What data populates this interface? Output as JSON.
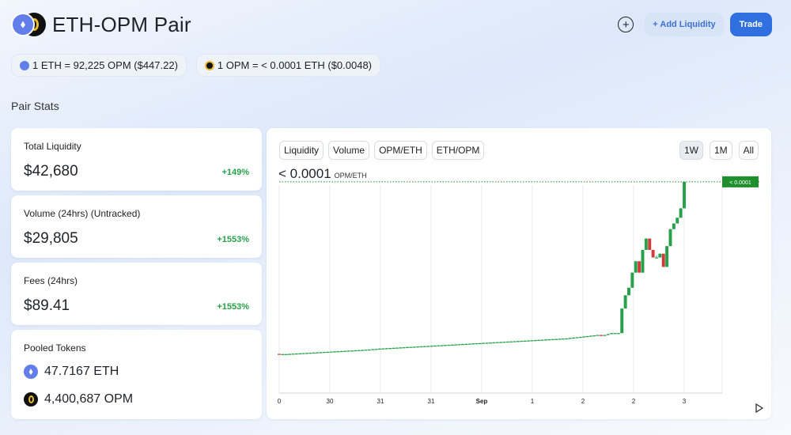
{
  "header": {
    "title": "ETH-OPM Pair",
    "add_liquidity_label": "+ Add Liquidity",
    "trade_label": "Trade",
    "icons": [
      "eth-logo",
      "opm-logo",
      "plus-circle-icon"
    ]
  },
  "prices": {
    "eth_price": "1 ETH = 92,225 OPM ($447.22)",
    "opm_price": "1 OPM = < 0.0001 ETH ($0.0048)"
  },
  "section_title": "Pair Stats",
  "stats": [
    {
      "label": "Total Liquidity",
      "value": "$42,680",
      "change": "+149%"
    },
    {
      "label": "Volume (24hrs) (Untracked)",
      "value": "$29,805",
      "change": "+1553%"
    },
    {
      "label": "Fees (24hrs)",
      "value": "$89.41",
      "change": "+1553%"
    }
  ],
  "pooled": {
    "label": "Pooled Tokens",
    "tokens": [
      {
        "amount": "47.7167 ETH",
        "icon": "eth-icon"
      },
      {
        "amount": "4,400,687 OPM",
        "icon": "opm-icon"
      }
    ]
  },
  "chart": {
    "tabs": [
      "Liquidity",
      "Volume",
      "OPM/ETH",
      "ETH/OPM"
    ],
    "ranges": [
      "1W",
      "1M",
      "All"
    ],
    "active_range": "1W",
    "price": "< 0.0001",
    "price_unit": "OPM/ETH",
    "last_price_label": "< 0.0001",
    "colors": {
      "up": "#27a04a",
      "down": "#d23a3a",
      "last_price": "#1f8f2e",
      "grid": "#e6e8ec"
    }
  },
  "chart_data": {
    "type": "candlestick",
    "x_tick_labels": [
      "0",
      "30",
      "31",
      "31",
      "Sep",
      "1",
      "2",
      "2",
      "3"
    ],
    "y_ticks": [],
    "price_level_label": "< 0.0001",
    "last_value": 1.0,
    "ylim": [
      0,
      1.1
    ],
    "candles": [
      {
        "o": 0.09,
        "c": 0.088,
        "h": 0.09,
        "l": 0.087
      },
      {
        "o": 0.088,
        "c": 0.089,
        "h": 0.09,
        "l": 0.087
      },
      {
        "o": 0.089,
        "c": 0.089,
        "h": 0.09,
        "l": 0.088
      },
      {
        "o": 0.089,
        "c": 0.09,
        "h": 0.091,
        "l": 0.088
      },
      {
        "o": 0.09,
        "c": 0.091,
        "h": 0.092,
        "l": 0.089
      },
      {
        "o": 0.091,
        "c": 0.092,
        "h": 0.093,
        "l": 0.09
      },
      {
        "o": 0.092,
        "c": 0.093,
        "h": 0.094,
        "l": 0.091
      },
      {
        "o": 0.093,
        "c": 0.094,
        "h": 0.095,
        "l": 0.092
      },
      {
        "o": 0.094,
        "c": 0.095,
        "h": 0.096,
        "l": 0.093
      },
      {
        "o": 0.095,
        "c": 0.096,
        "h": 0.097,
        "l": 0.094
      },
      {
        "o": 0.096,
        "c": 0.097,
        "h": 0.098,
        "l": 0.095
      },
      {
        "o": 0.097,
        "c": 0.098,
        "h": 0.099,
        "l": 0.096
      },
      {
        "o": 0.098,
        "c": 0.099,
        "h": 0.1,
        "l": 0.097
      },
      {
        "o": 0.099,
        "c": 0.1,
        "h": 0.101,
        "l": 0.098
      },
      {
        "o": 0.1,
        "c": 0.101,
        "h": 0.102,
        "l": 0.099
      },
      {
        "o": 0.101,
        "c": 0.102,
        "h": 0.103,
        "l": 0.1
      },
      {
        "o": 0.102,
        "c": 0.103,
        "h": 0.104,
        "l": 0.101
      },
      {
        "o": 0.103,
        "c": 0.104,
        "h": 0.105,
        "l": 0.102
      },
      {
        "o": 0.104,
        "c": 0.105,
        "h": 0.106,
        "l": 0.103
      },
      {
        "o": 0.105,
        "c": 0.106,
        "h": 0.107,
        "l": 0.104
      },
      {
        "o": 0.106,
        "c": 0.107,
        "h": 0.108,
        "l": 0.105
      },
      {
        "o": 0.107,
        "c": 0.108,
        "h": 0.109,
        "l": 0.106
      },
      {
        "o": 0.108,
        "c": 0.109,
        "h": 0.11,
        "l": 0.107
      },
      {
        "o": 0.109,
        "c": 0.11,
        "h": 0.111,
        "l": 0.108
      },
      {
        "o": 0.11,
        "c": 0.111,
        "h": 0.112,
        "l": 0.109
      },
      {
        "o": 0.111,
        "c": 0.112,
        "h": 0.113,
        "l": 0.11
      },
      {
        "o": 0.112,
        "c": 0.113,
        "h": 0.114,
        "l": 0.111
      },
      {
        "o": 0.113,
        "c": 0.115,
        "h": 0.116,
        "l": 0.112
      },
      {
        "o": 0.115,
        "c": 0.116,
        "h": 0.117,
        "l": 0.114
      },
      {
        "o": 0.116,
        "c": 0.118,
        "h": 0.119,
        "l": 0.115
      },
      {
        "o": 0.118,
        "c": 0.119,
        "h": 0.12,
        "l": 0.117
      },
      {
        "o": 0.119,
        "c": 0.12,
        "h": 0.121,
        "l": 0.118
      },
      {
        "o": 0.12,
        "c": 0.121,
        "h": 0.122,
        "l": 0.119
      },
      {
        "o": 0.121,
        "c": 0.122,
        "h": 0.123,
        "l": 0.12
      },
      {
        "o": 0.122,
        "c": 0.123,
        "h": 0.124,
        "l": 0.121
      },
      {
        "o": 0.123,
        "c": 0.124,
        "h": 0.125,
        "l": 0.122
      },
      {
        "o": 0.124,
        "c": 0.125,
        "h": 0.126,
        "l": 0.123
      },
      {
        "o": 0.125,
        "c": 0.126,
        "h": 0.127,
        "l": 0.124
      },
      {
        "o": 0.126,
        "c": 0.127,
        "h": 0.128,
        "l": 0.125
      },
      {
        "o": 0.127,
        "c": 0.128,
        "h": 0.129,
        "l": 0.126
      },
      {
        "o": 0.128,
        "c": 0.129,
        "h": 0.13,
        "l": 0.127
      },
      {
        "o": 0.129,
        "c": 0.13,
        "h": 0.131,
        "l": 0.128
      },
      {
        "o": 0.13,
        "c": 0.131,
        "h": 0.132,
        "l": 0.129
      },
      {
        "o": 0.131,
        "c": 0.132,
        "h": 0.133,
        "l": 0.13
      },
      {
        "o": 0.132,
        "c": 0.133,
        "h": 0.134,
        "l": 0.131
      },
      {
        "o": 0.133,
        "c": 0.134,
        "h": 0.135,
        "l": 0.132
      },
      {
        "o": 0.134,
        "c": 0.135,
        "h": 0.136,
        "l": 0.133
      },
      {
        "o": 0.135,
        "c": 0.136,
        "h": 0.137,
        "l": 0.134
      },
      {
        "o": 0.136,
        "c": 0.137,
        "h": 0.138,
        "l": 0.135
      },
      {
        "o": 0.137,
        "c": 0.138,
        "h": 0.139,
        "l": 0.136
      },
      {
        "o": 0.138,
        "c": 0.139,
        "h": 0.14,
        "l": 0.137
      },
      {
        "o": 0.139,
        "c": 0.14,
        "h": 0.141,
        "l": 0.138
      },
      {
        "o": 0.14,
        "c": 0.141,
        "h": 0.142,
        "l": 0.139
      },
      {
        "o": 0.141,
        "c": 0.142,
        "h": 0.143,
        "l": 0.14
      },
      {
        "o": 0.142,
        "c": 0.143,
        "h": 0.144,
        "l": 0.141
      },
      {
        "o": 0.143,
        "c": 0.144,
        "h": 0.145,
        "l": 0.142
      },
      {
        "o": 0.144,
        "c": 0.145,
        "h": 0.146,
        "l": 0.143
      },
      {
        "o": 0.145,
        "c": 0.146,
        "h": 0.147,
        "l": 0.144
      },
      {
        "o": 0.146,
        "c": 0.147,
        "h": 0.148,
        "l": 0.145
      },
      {
        "o": 0.147,
        "c": 0.148,
        "h": 0.149,
        "l": 0.146
      },
      {
        "o": 0.148,
        "c": 0.149,
        "h": 0.15,
        "l": 0.147
      },
      {
        "o": 0.149,
        "c": 0.15,
        "h": 0.151,
        "l": 0.148
      },
      {
        "o": 0.15,
        "c": 0.151,
        "h": 0.152,
        "l": 0.149
      },
      {
        "o": 0.151,
        "c": 0.152,
        "h": 0.153,
        "l": 0.15
      },
      {
        "o": 0.152,
        "c": 0.153,
        "h": 0.154,
        "l": 0.151
      },
      {
        "o": 0.153,
        "c": 0.154,
        "h": 0.155,
        "l": 0.152
      },
      {
        "o": 0.154,
        "c": 0.155,
        "h": 0.156,
        "l": 0.153
      },
      {
        "o": 0.155,
        "c": 0.156,
        "h": 0.157,
        "l": 0.154
      },
      {
        "o": 0.156,
        "c": 0.157,
        "h": 0.158,
        "l": 0.155
      },
      {
        "o": 0.157,
        "c": 0.158,
        "h": 0.159,
        "l": 0.156
      },
      {
        "o": 0.158,
        "c": 0.159,
        "h": 0.16,
        "l": 0.157
      },
      {
        "o": 0.159,
        "c": 0.16,
        "h": 0.161,
        "l": 0.158
      },
      {
        "o": 0.16,
        "c": 0.161,
        "h": 0.162,
        "l": 0.159
      },
      {
        "o": 0.161,
        "c": 0.162,
        "h": 0.163,
        "l": 0.16
      },
      {
        "o": 0.162,
        "c": 0.163,
        "h": 0.164,
        "l": 0.161
      },
      {
        "o": 0.163,
        "c": 0.164,
        "h": 0.165,
        "l": 0.162
      },
      {
        "o": 0.164,
        "c": 0.165,
        "h": 0.166,
        "l": 0.163
      },
      {
        "o": 0.165,
        "c": 0.166,
        "h": 0.167,
        "l": 0.164
      },
      {
        "o": 0.166,
        "c": 0.167,
        "h": 0.168,
        "l": 0.165
      },
      {
        "o": 0.167,
        "c": 0.168,
        "h": 0.169,
        "l": 0.166
      },
      {
        "o": 0.168,
        "c": 0.169,
        "h": 0.17,
        "l": 0.167
      },
      {
        "o": 0.169,
        "c": 0.17,
        "h": 0.171,
        "l": 0.168
      },
      {
        "o": 0.17,
        "c": 0.171,
        "h": 0.172,
        "l": 0.169
      },
      {
        "o": 0.171,
        "c": 0.172,
        "h": 0.173,
        "l": 0.17
      },
      {
        "o": 0.172,
        "c": 0.174,
        "h": 0.175,
        "l": 0.171
      },
      {
        "o": 0.174,
        "c": 0.176,
        "h": 0.177,
        "l": 0.173
      },
      {
        "o": 0.176,
        "c": 0.178,
        "h": 0.179,
        "l": 0.175
      },
      {
        "o": 0.178,
        "c": 0.18,
        "h": 0.181,
        "l": 0.177
      },
      {
        "o": 0.18,
        "c": 0.182,
        "h": 0.183,
        "l": 0.179
      },
      {
        "o": 0.182,
        "c": 0.184,
        "h": 0.185,
        "l": 0.181
      },
      {
        "o": 0.184,
        "c": 0.186,
        "h": 0.187,
        "l": 0.183
      },
      {
        "o": 0.186,
        "c": 0.188,
        "h": 0.189,
        "l": 0.185
      },
      {
        "o": 0.188,
        "c": 0.19,
        "h": 0.191,
        "l": 0.187
      },
      {
        "o": 0.19,
        "c": 0.186,
        "h": 0.191,
        "l": 0.185
      },
      {
        "o": 0.186,
        "c": 0.19,
        "h": 0.191,
        "l": 0.185
      },
      {
        "o": 0.19,
        "c": 0.195,
        "h": 0.196,
        "l": 0.189
      },
      {
        "o": 0.195,
        "c": 0.2,
        "h": 0.2,
        "l": 0.194
      },
      {
        "o": 0.2,
        "c": 0.2,
        "h": 0.201,
        "l": 0.199
      },
      {
        "o": 0.2,
        "c": 0.2,
        "h": 0.2,
        "l": 0.199
      },
      {
        "o": 0.2,
        "c": 0.33,
        "h": 0.33,
        "l": 0.2
      },
      {
        "o": 0.33,
        "c": 0.4,
        "h": 0.4,
        "l": 0.33
      },
      {
        "o": 0.4,
        "c": 0.44,
        "h": 0.44,
        "l": 0.4
      },
      {
        "o": 0.44,
        "c": 0.52,
        "h": 0.52,
        "l": 0.44
      },
      {
        "o": 0.52,
        "c": 0.58,
        "h": 0.58,
        "l": 0.52
      },
      {
        "o": 0.58,
        "c": 0.52,
        "h": 0.58,
        "l": 0.52
      },
      {
        "o": 0.52,
        "c": 0.64,
        "h": 0.64,
        "l": 0.52
      },
      {
        "o": 0.64,
        "c": 0.7,
        "h": 0.7,
        "l": 0.64
      },
      {
        "o": 0.7,
        "c": 0.64,
        "h": 0.7,
        "l": 0.64
      },
      {
        "o": 0.64,
        "c": 0.6,
        "h": 0.64,
        "l": 0.6
      },
      {
        "o": 0.6,
        "c": 0.6,
        "h": 0.61,
        "l": 0.6
      },
      {
        "o": 0.6,
        "c": 0.62,
        "h": 0.62,
        "l": 0.6
      },
      {
        "o": 0.62,
        "c": 0.55,
        "h": 0.62,
        "l": 0.55
      },
      {
        "o": 0.55,
        "c": 0.66,
        "h": 0.66,
        "l": 0.55
      },
      {
        "o": 0.66,
        "c": 0.75,
        "h": 0.75,
        "l": 0.66
      },
      {
        "o": 0.75,
        "c": 0.78,
        "h": 0.78,
        "l": 0.75
      },
      {
        "o": 0.78,
        "c": 0.81,
        "h": 0.81,
        "l": 0.78
      },
      {
        "o": 0.81,
        "c": 0.86,
        "h": 0.86,
        "l": 0.81
      },
      {
        "o": 0.86,
        "c": 1.0,
        "h": 1.0,
        "l": 0.86
      }
    ]
  }
}
